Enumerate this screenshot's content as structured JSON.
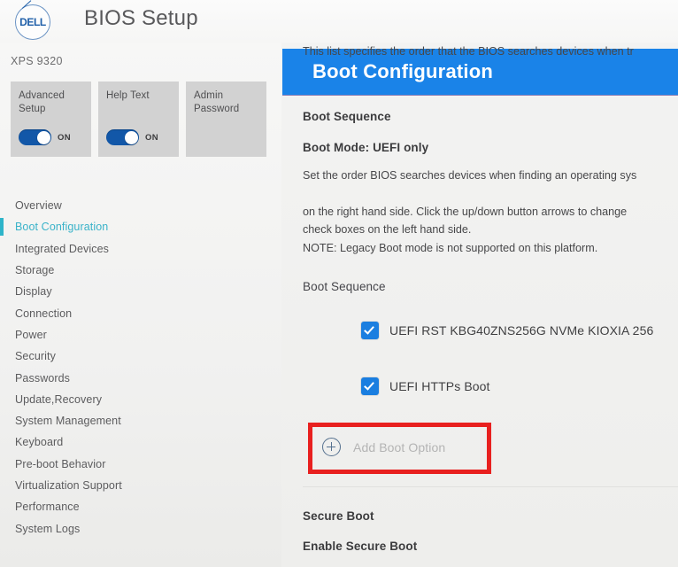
{
  "header": {
    "logo_alt": "DELL",
    "title": "BIOS Setup"
  },
  "sidebar": {
    "model": "XPS 9320",
    "cards": [
      {
        "label": "Advanced Setup",
        "toggle": true,
        "state": "ON"
      },
      {
        "label": "Help Text",
        "toggle": true,
        "state": "ON"
      },
      {
        "label": "Admin Password",
        "toggle": false,
        "state": ""
      }
    ],
    "nav": [
      {
        "label": "Overview",
        "active": false
      },
      {
        "label": "Boot Configuration",
        "active": true
      },
      {
        "label": "Integrated Devices",
        "active": false
      },
      {
        "label": "Storage",
        "active": false
      },
      {
        "label": "Display",
        "active": false
      },
      {
        "label": "Connection",
        "active": false
      },
      {
        "label": "Power",
        "active": false
      },
      {
        "label": "Security",
        "active": false
      },
      {
        "label": "Passwords",
        "active": false
      },
      {
        "label": "Update,Recovery",
        "active": false
      },
      {
        "label": "System Management",
        "active": false
      },
      {
        "label": "Keyboard",
        "active": false
      },
      {
        "label": "Pre-boot Behavior",
        "active": false
      },
      {
        "label": "Virtualization Support",
        "active": false
      },
      {
        "label": "Performance",
        "active": false
      },
      {
        "label": "System Logs",
        "active": false
      }
    ]
  },
  "content": {
    "banner_title": "Boot Configuration",
    "section_heading": "Boot Sequence",
    "boot_mode": "Boot Mode: UEFI only",
    "description_lines": [
      "Set the order BIOS searches devices when finding an operating sys",
      "This list specifies the order that the BIOS searches devices when tr",
      "on the right hand side.  Click the up/down button arrows to change",
      "check boxes on the left hand side.",
      "NOTE: Legacy Boot mode is not supported on this platform."
    ],
    "list_heading": "Boot Sequence",
    "boot_entries": [
      {
        "label": "UEFI RST KBG40ZNS256G NVMe KIOXIA 256",
        "checked": true
      },
      {
        "label": "UEFI HTTPs Boot",
        "checked": true
      }
    ],
    "add_boot_option": "Add Boot Option",
    "secure_boot_heading": "Secure Boot",
    "enable_secure_boot": "Enable Secure Boot"
  },
  "colors": {
    "banner_blue": "#1a83e8",
    "accent_teal": "#2eb4c9",
    "checkbox_blue": "#1a7ee0",
    "toggle_blue": "#1257a8",
    "highlight_red": "#e8201f"
  }
}
